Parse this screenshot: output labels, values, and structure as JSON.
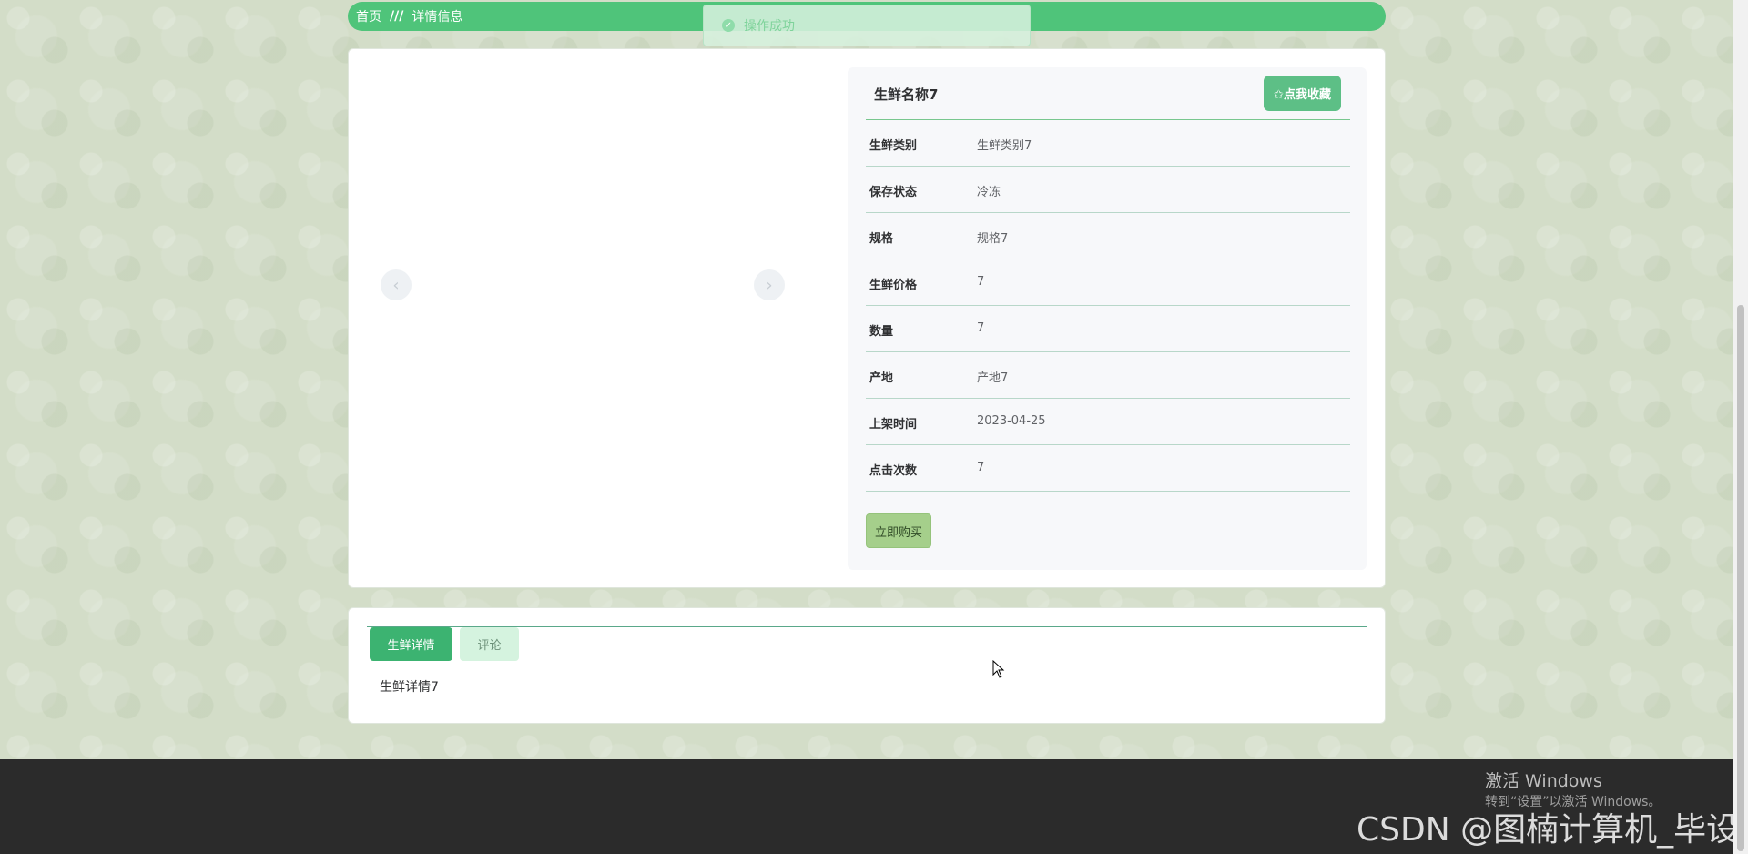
{
  "breadcrumb": {
    "home": "首页",
    "separator": "///",
    "current": "详情信息"
  },
  "toast": {
    "message": "操作成功",
    "icon": "check-circle-icon"
  },
  "product": {
    "title": "生鲜名称7",
    "favorite_label": "✩点我收藏",
    "fields": [
      {
        "label": "生鲜类别",
        "value": "生鲜类别7"
      },
      {
        "label": "保存状态",
        "value": "冷冻"
      },
      {
        "label": "规格",
        "value": "规格7"
      },
      {
        "label": "生鲜价格",
        "value": "7"
      },
      {
        "label": "数量",
        "value": "7"
      },
      {
        "label": "产地",
        "value": "产地7"
      },
      {
        "label": "上架时间",
        "value": "2023-04-25"
      },
      {
        "label": "点击次数",
        "value": "7"
      }
    ],
    "buy_label": "立即购买"
  },
  "carousel": {
    "prev_icon": "‹",
    "next_icon": "›"
  },
  "tabs": [
    {
      "label": "生鲜详情",
      "active": true
    },
    {
      "label": "评论",
      "active": false
    }
  ],
  "detail_content": "生鲜详情7",
  "os_watermark": {
    "title": "激活 Windows",
    "subtitle": "转到“设置”以激活 Windows。"
  },
  "csdn_watermark": "CSDN @图楠计算机_毕设",
  "colors": {
    "accent": "#4fc47a",
    "tab_active": "#3cb371",
    "footer": "#2b2b2b"
  }
}
